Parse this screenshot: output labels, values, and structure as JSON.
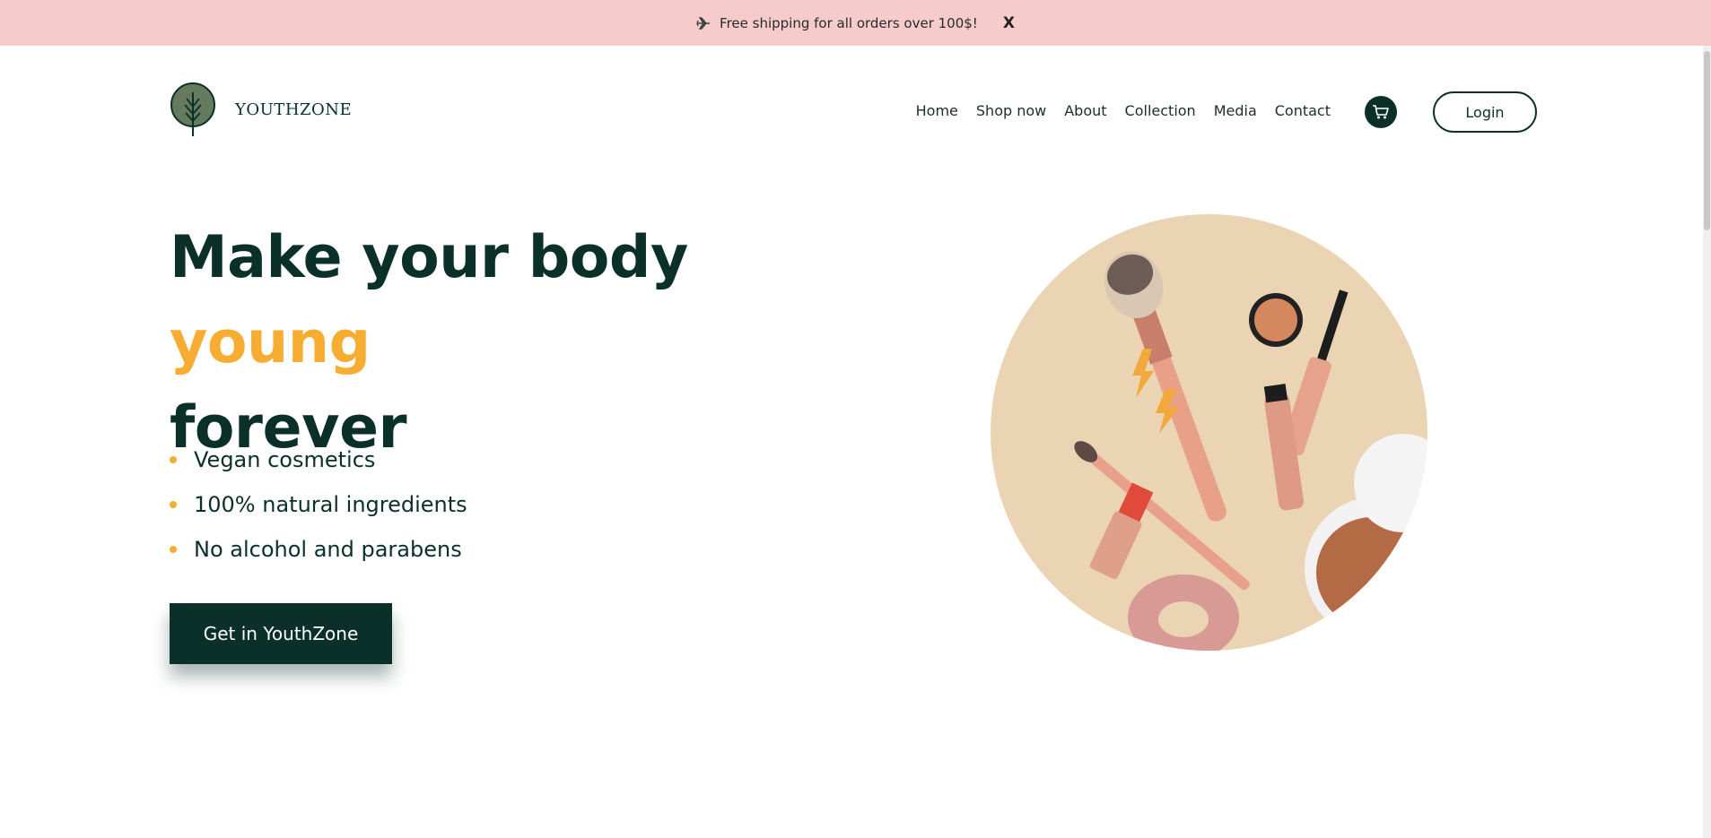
{
  "announcement": {
    "icon": "plane-icon",
    "text": "Free shipping for all orders over 100$!",
    "close_label": "X"
  },
  "brand": {
    "logo_icon": "tree-icon",
    "name": "YOUTHZONE"
  },
  "nav": {
    "items": [
      {
        "label": "Home"
      },
      {
        "label": "Shop now"
      },
      {
        "label": "About"
      },
      {
        "label": "Collection"
      },
      {
        "label": "Media"
      },
      {
        "label": "Contact"
      }
    ],
    "cart_icon": "cart-icon",
    "login_label": "Login"
  },
  "hero": {
    "title_part1": "Make your body ",
    "title_accent": "young",
    "title_part2": "forever",
    "features": [
      {
        "text": "Vegan cosmetics"
      },
      {
        "text": "100% natural ingredients"
      },
      {
        "text": "No alcohol and parabens"
      }
    ],
    "cta_label": "Get in YouthZone",
    "image": "makeup-products-image"
  },
  "colors": {
    "primary": "#0b3029",
    "accent": "#f6ad31",
    "banner": "#f6cbcc",
    "image_bg": "#ebd4b4"
  }
}
